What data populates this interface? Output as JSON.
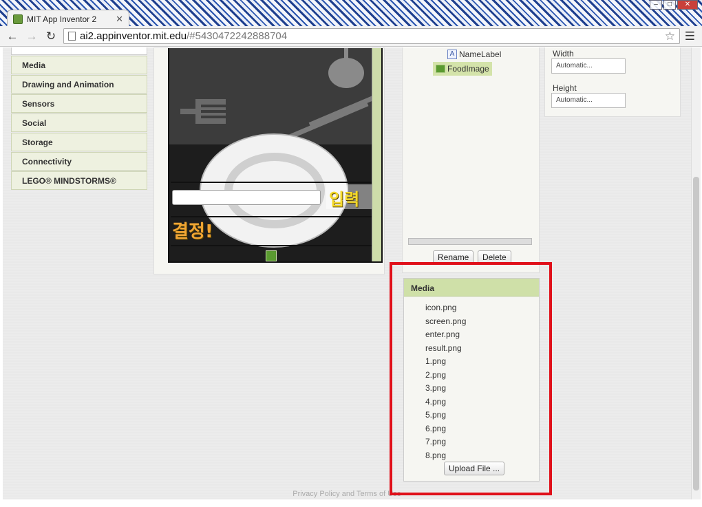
{
  "browser": {
    "tab_title": "MIT App Inventor 2",
    "url_host": "ai2.appinventor.mit.edu",
    "url_path": "/#5430472242888704",
    "icons": [
      "back-icon",
      "forward-icon",
      "reload-icon",
      "page-icon",
      "star-icon",
      "menu-icon"
    ]
  },
  "palette": {
    "items": [
      {
        "label": "Media"
      },
      {
        "label": "Drawing and Animation"
      },
      {
        "label": "Sensors"
      },
      {
        "label": "Social"
      },
      {
        "label": "Storage"
      },
      {
        "label": "Connectivity"
      },
      {
        "label": "LEGO® MINDSTORMS®"
      }
    ]
  },
  "viewer": {
    "enter_button": "입력",
    "decide_button": "결정!"
  },
  "components": {
    "tree": [
      {
        "label": "NameLabel",
        "icon": "label-icon",
        "selected": false
      },
      {
        "label": "FoodImage",
        "icon": "image-icon",
        "selected": true
      }
    ],
    "rename_label": "Rename",
    "delete_label": "Delete"
  },
  "properties": {
    "width_label": "Width",
    "width_value": "Automatic...",
    "height_label": "Height",
    "height_value": "Automatic..."
  },
  "media": {
    "title": "Media",
    "files": [
      "icon.png",
      "screen.png",
      "enter.png",
      "result.png",
      "1.png",
      "2.png",
      "3.png",
      "4.png",
      "5.png",
      "6.png",
      "7.png",
      "8.png"
    ],
    "upload_label": "Upload File ..."
  },
  "footer": {
    "text": "Privacy Policy and Terms of Use"
  },
  "colors": {
    "panel_header": "#cfe0a8",
    "highlight": "#e0101a",
    "palette_item": "#eef1e0"
  }
}
